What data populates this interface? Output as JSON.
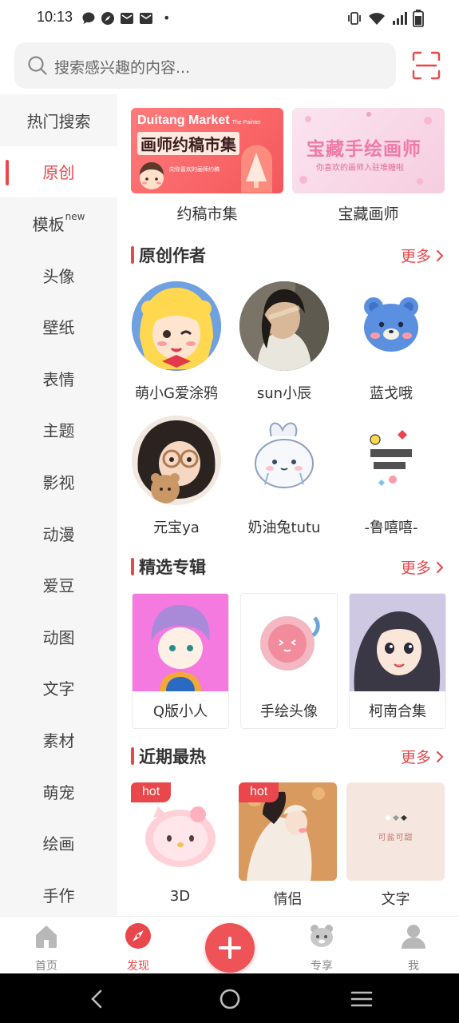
{
  "status_bar": {
    "time": "10:13",
    "notifications": [
      "chat-bubble-icon",
      "compass-icon",
      "mail-icon",
      "mail-icon"
    ],
    "dot": "•",
    "system_icons": [
      "vibrate-icon",
      "wifi-icon",
      "signal-icon",
      "battery-icon"
    ]
  },
  "search": {
    "placeholder": "搜索感兴趣的内容..."
  },
  "sidebar": {
    "items": [
      {
        "label": "热门搜索",
        "badge": ""
      },
      {
        "label": "原创",
        "badge": "",
        "active": true
      },
      {
        "label": "模板",
        "badge": "new"
      },
      {
        "label": "头像",
        "badge": ""
      },
      {
        "label": "壁纸",
        "badge": ""
      },
      {
        "label": "表情",
        "badge": ""
      },
      {
        "label": "主题",
        "badge": ""
      },
      {
        "label": "影视",
        "badge": ""
      },
      {
        "label": "动漫",
        "badge": ""
      },
      {
        "label": "爱豆",
        "badge": ""
      },
      {
        "label": "动图",
        "badge": ""
      },
      {
        "label": "文字",
        "badge": ""
      },
      {
        "label": "素材",
        "badge": ""
      },
      {
        "label": "萌宠",
        "badge": ""
      },
      {
        "label": "绘画",
        "badge": ""
      },
      {
        "label": "手作",
        "badge": ""
      }
    ]
  },
  "banners": [
    {
      "caption": "约稿市集",
      "brand": "Duitang Market",
      "brand_sub": "The Painter",
      "headline": "画师约稿市集",
      "sub": "向你喜欢的画师约稿"
    },
    {
      "caption": "宝藏画师",
      "headline": "宝藏手绘画师",
      "sub": "你喜欢的画师入驻堆糖啦"
    }
  ],
  "sections": {
    "authors": {
      "title": "原创作者",
      "more": "更多"
    },
    "albums": {
      "title": "精选专辑",
      "more": "更多"
    },
    "hot": {
      "title": "近期最热",
      "more": "更多"
    }
  },
  "authors": [
    {
      "name": "萌小G爱涂鸦"
    },
    {
      "name": "sun小辰"
    },
    {
      "name": "蓝戈哦"
    },
    {
      "name": "元宝ya"
    },
    {
      "name": "奶油兔tutu"
    },
    {
      "name": "-鲁嘻嘻-"
    }
  ],
  "albums": [
    {
      "name": "Q版小人"
    },
    {
      "name": "手绘头像"
    },
    {
      "name": "柯南合集"
    }
  ],
  "hot_items": [
    {
      "name": "3D",
      "badge": "hot"
    },
    {
      "name": "情侣",
      "badge": "hot"
    },
    {
      "name": "文字",
      "badge": "",
      "text_art": "可盐可甜"
    }
  ],
  "tabbar": {
    "items": [
      {
        "label": "首页",
        "icon": "home-icon"
      },
      {
        "label": "发现",
        "icon": "compass-icon",
        "active": true
      },
      {
        "label": "",
        "icon": "plus-icon"
      },
      {
        "label": "专享",
        "icon": "bear-icon"
      },
      {
        "label": "我",
        "icon": "profile-icon"
      }
    ]
  },
  "colors": {
    "accent": "#e9474b",
    "sidebar_bg": "#f6f6f6",
    "search_bg": "#f3f3f3"
  }
}
